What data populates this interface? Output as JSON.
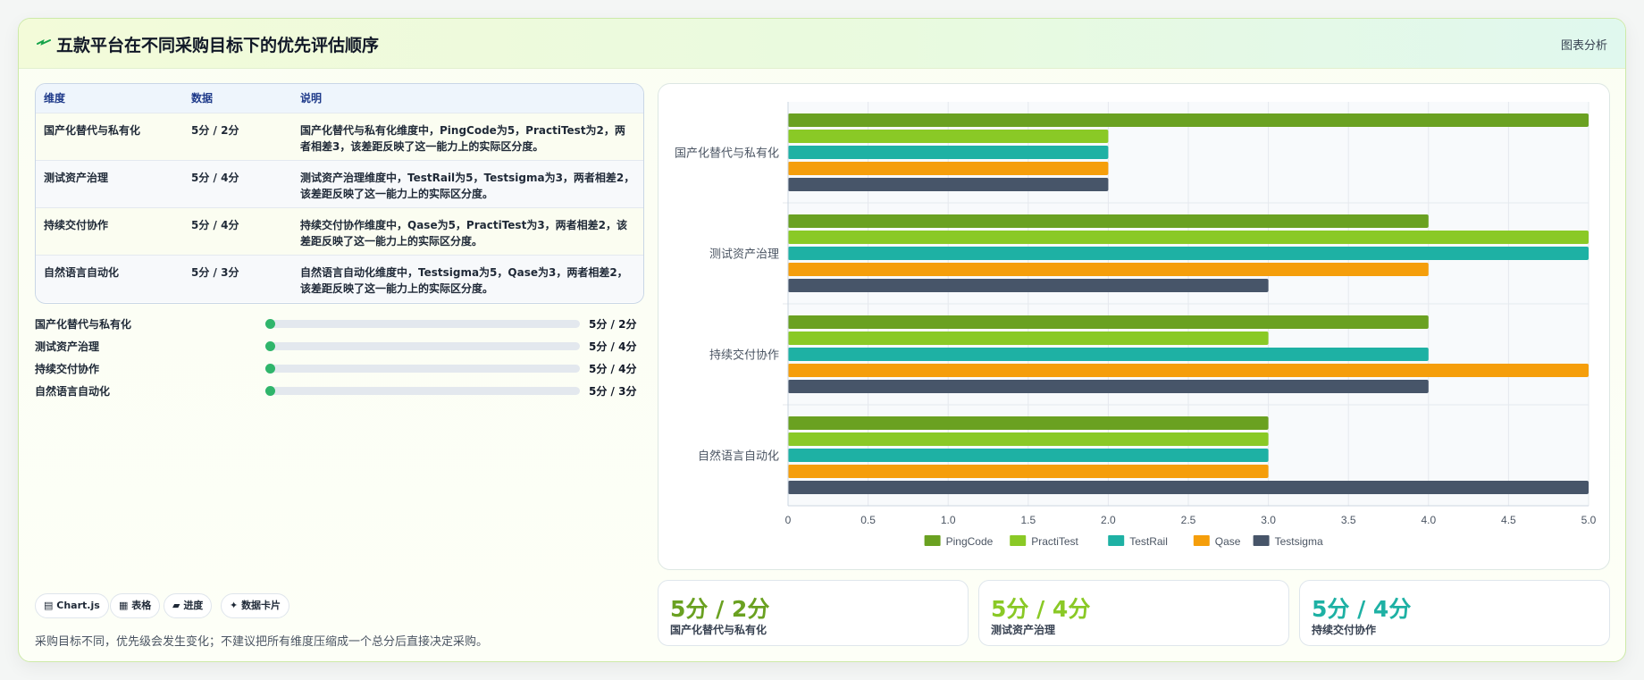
{
  "header": {
    "title": "五款平台在不同采购目标下的优先评估顺序",
    "link": "图表分析",
    "icon": "spark-icon"
  },
  "table": {
    "headers": [
      "维度",
      "数据",
      "说明"
    ],
    "rows": [
      {
        "dim": "国产化替代与私有化",
        "data": "5分 / 2分",
        "desc": "国产化替代与私有化维度中，PingCode为5，PractiTest为2，两者相差3，该差距反映了这一能力上的实际区分度。"
      },
      {
        "dim": "测试资产治理",
        "data": "5分 / 4分",
        "desc": "测试资产治理维度中，TestRail为5，Testsigma为3，两者相差2，该差距反映了这一能力上的实际区分度。"
      },
      {
        "dim": "持续交付协作",
        "data": "5分 / 4分",
        "desc": "持续交付协作维度中，Qase为5，PractiTest为3，两者相差2，该差距反映了这一能力上的实际区分度。"
      },
      {
        "dim": "自然语言自动化",
        "data": "5分 / 3分",
        "desc": "自然语言自动化维度中，Testsigma为5，Qase为3，两者相差2，该差距反映了这一能力上的实际区分度。"
      }
    ]
  },
  "progress": [
    {
      "label": "国产化替代与私有化",
      "value": "5分 / 2分",
      "level": 0.0
    },
    {
      "label": "测试资产治理",
      "value": "5分 / 4分",
      "level": 0.0
    },
    {
      "label": "持续交付协作",
      "value": "5分 / 4分",
      "level": 0.0
    },
    {
      "label": "自然语言自动化",
      "value": "5分 / 3分",
      "level": 0.0
    }
  ],
  "chips": [
    {
      "icon": "chart-icon",
      "glyph": "▤",
      "label": "Chart.js"
    },
    {
      "icon": "table-icon",
      "glyph": "▦",
      "label": "表格"
    },
    {
      "icon": "progress-icon",
      "glyph": "▰",
      "label": "进度"
    },
    {
      "icon": "data-card-icon",
      "glyph": "✦",
      "label": "数据卡片"
    }
  ],
  "footer_note": "采购目标不同，优先级会发生变化；不建议把所有维度压缩成一个总分后直接决定采购。",
  "stats": [
    {
      "value": "5分 / 2分",
      "label": "国产化替代与私有化",
      "color": "#6aa121"
    },
    {
      "value": "5分 / 4分",
      "label": "测试资产治理",
      "color": "#8ac926"
    },
    {
      "value": "5分 / 4分",
      "label": "持续交付协作",
      "color": "#1eb1a4"
    }
  ],
  "chart_data": {
    "type": "bar",
    "orientation": "horizontal",
    "categories": [
      "国产化替代与私有化",
      "测试资产治理",
      "持续交付协作",
      "自然语言自动化"
    ],
    "series": [
      {
        "name": "PingCode",
        "color": "#6aa121",
        "values": [
          5,
          4,
          4,
          3
        ]
      },
      {
        "name": "PractiTest",
        "color": "#8ac926",
        "values": [
          2,
          5,
          3,
          3
        ]
      },
      {
        "name": "TestRail",
        "color": "#1eb1a4",
        "values": [
          2,
          5,
          4,
          3
        ]
      },
      {
        "name": "Qase",
        "color": "#f59e0b",
        "values": [
          2,
          4,
          5,
          3
        ]
      },
      {
        "name": "Testsigma",
        "color": "#475569",
        "values": [
          2,
          3,
          4,
          5
        ]
      }
    ],
    "xlim": [
      0,
      5
    ],
    "ticks": [
      "0",
      "0.5",
      "1.0",
      "1.5",
      "2.0",
      "2.5",
      "3.0",
      "3.5",
      "4.0",
      "4.5",
      "5.0"
    ],
    "grid": true,
    "legend": "bottom"
  }
}
